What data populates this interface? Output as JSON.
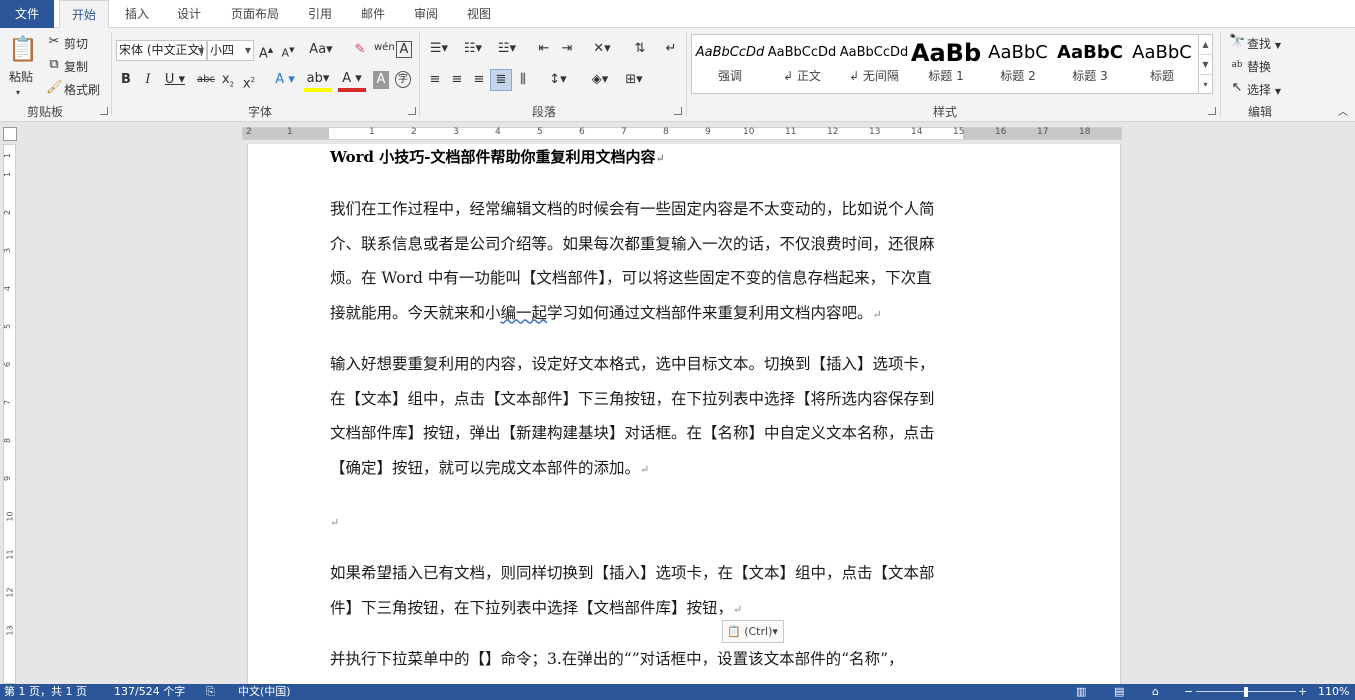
{
  "tabs": [
    "文件",
    "开始",
    "插入",
    "设计",
    "页面布局",
    "引用",
    "邮件",
    "审阅",
    "视图"
  ],
  "ribbon": {
    "clipboard": {
      "paste": "粘贴",
      "cut": "剪切",
      "copy": "复制",
      "format_painter": "格式刷",
      "label": "剪贴板"
    },
    "font": {
      "font_name": "宋体 (中文正文)",
      "font_size": "小四",
      "label": "字体"
    },
    "paragraph": {
      "label": "段落"
    },
    "styles": {
      "label": "样式",
      "items": [
        {
          "sample": "AaBbCcDd",
          "name": "强调"
        },
        {
          "sample": "AaBbCcDd",
          "name": "↲ 正文"
        },
        {
          "sample": "AaBbCcDd",
          "name": "↲ 无间隔"
        },
        {
          "sample": "AaBb",
          "name": "标题 1"
        },
        {
          "sample": "AaBbC",
          "name": "标题 2"
        },
        {
          "sample": "AaBbC",
          "name": "标题 3"
        },
        {
          "sample": "AaBbC",
          "name": "标题"
        }
      ]
    },
    "editing": {
      "find": "查找",
      "replace": "替换",
      "select": "选择",
      "label": "编辑"
    }
  },
  "ruler": {
    "h_numbers": [
      "2",
      "1",
      "1",
      "2",
      "3",
      "4",
      "5",
      "6",
      "7",
      "8",
      "9",
      "10",
      "11",
      "12",
      "13",
      "14",
      "15",
      "16",
      "17",
      "18"
    ],
    "v_numbers": [
      "1",
      "1",
      "2",
      "3",
      "4",
      "5",
      "6",
      "7",
      "8",
      "9",
      "10",
      "11",
      "12",
      "13"
    ]
  },
  "document": {
    "title": "Word 小技巧-文档部件帮助你重复利用文档内容",
    "p1_lines": [
      "我们在工作过程中，经常编辑文档的时候会有一些固定内容是不太变动的，比如说个人简",
      "介、联系信息或者是公司介绍等。如果每次都重复输入一次的话，不仅浪费时间，还很麻",
      "烦。在 Word 中有一功能叫【文档部件】，可以将这些固定不变的信息存档起来，下次直"
    ],
    "p1_last_a": "接就能用。今天就来和小",
    "p1_last_squiggle": "编一起",
    "p1_last_b": "学习如何通过文档部件来重复利用文档内容吧。",
    "p2_lines": [
      "输入好想要重复利用的内容，设定好文本格式，选中目标文本。切换到【插入】选项卡，",
      "在【文本】组中，点击【文本部件】下三角按钮，在下拉列表中选择【将所选内容保存到",
      "文档部件库】按钮，弹出【新建构建基块】对话框。在【名称】中自定义文本名称，点击",
      "【确定】按钮，就可以完成文本部件的添加。"
    ],
    "p3_lines": [
      "如果希望插入已有文档，则同样切换到【插入】选项卡，在【文本】组中，点击【文本部",
      "件】下三角按钮，在下拉列表中选择【文档部件库】按钮，"
    ],
    "p4_line": "并执行下拉菜单中的【】命令；3.在弹出的“”对话框中，设置该文本部件的“名称”，",
    "paste_options": "(Ctrl)"
  },
  "status": {
    "page": "第 1 页，共 1 页",
    "words": "137/524 个字",
    "language": "中文(中国)",
    "zoom": "110%"
  }
}
